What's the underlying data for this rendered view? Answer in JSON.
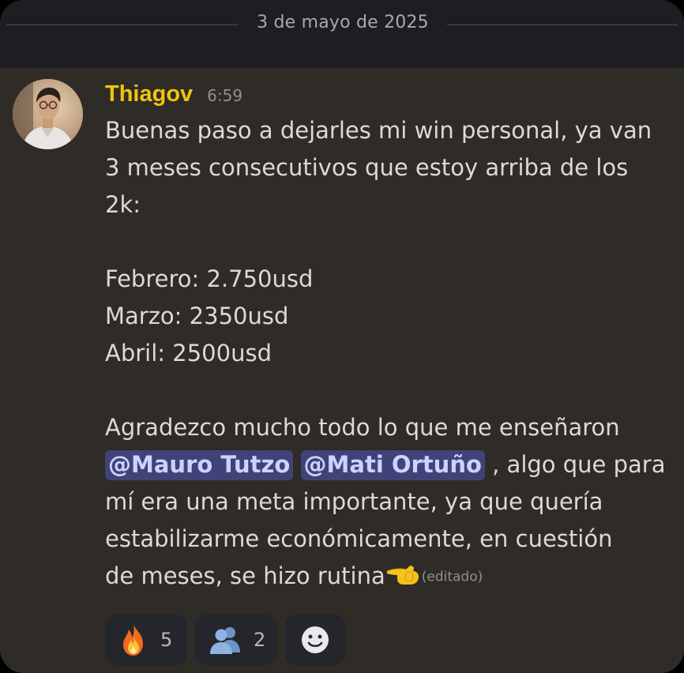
{
  "date_divider": "3 de mayo de 2025",
  "message": {
    "author": "Thiagov",
    "time": "6:59",
    "lines": [
      "Buenas paso a dejarles mi win personal, ya van",
      "3 meses consecutivos que estoy arriba de los",
      "2k:",
      "",
      "Febrero: 2.750usd",
      "Marzo: 2350usd",
      "Abril: 2500usd",
      "",
      "Agradezco mucho todo lo que me enseñaron"
    ],
    "mention_1": "@Mauro Tutzo",
    "mention_2": "@Mati Ortuño",
    "after_mentions": ", algo que para",
    "line_11": "mí era una meta importante, ya que quería",
    "line_12": "estabilizarme económicamente, en cuestión",
    "line_13": "de meses, se hizo rutina",
    "edited": "(editado)"
  },
  "reactions": [
    {
      "icon": "fire-icon",
      "count": "5"
    },
    {
      "icon": "people-icon",
      "count": "2"
    },
    {
      "icon": "add-reaction-icon",
      "count": ""
    }
  ],
  "colors": {
    "background": "#2f2b26",
    "date_bar": "#1c1e21",
    "username": "#f0c410",
    "mention_bg": "#3f4378",
    "mention_text": "#cdd2ff"
  }
}
